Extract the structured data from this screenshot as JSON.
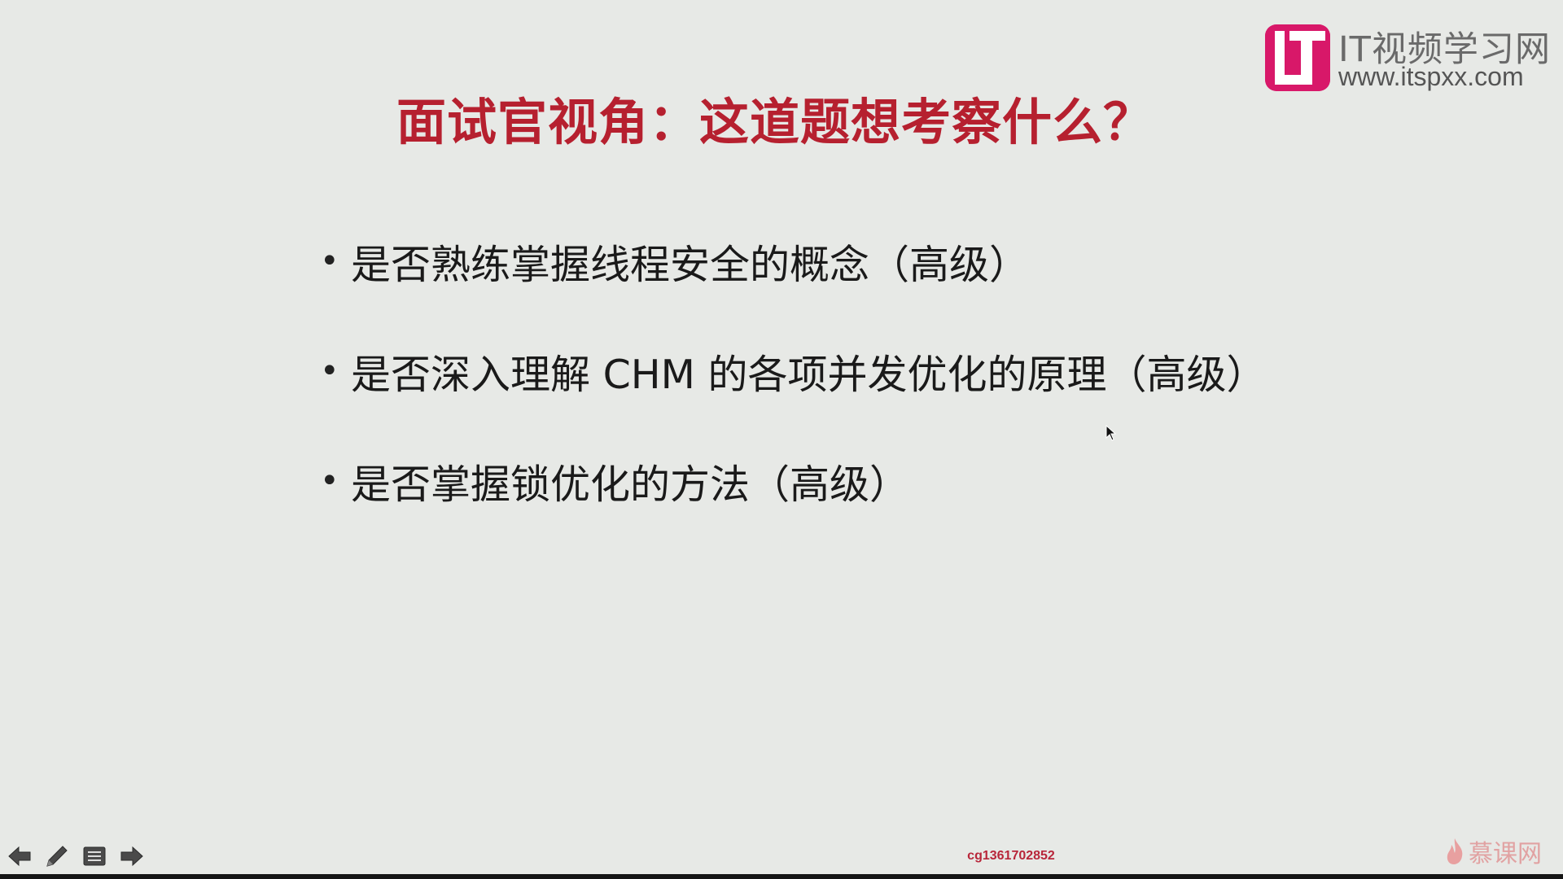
{
  "slide": {
    "title": "面试官视角：这道题想考察什么？",
    "bullets": [
      "是否熟练掌握线程安全的概念（高级）",
      "是否深入理解 CHM 的各项并发优化的原理（高级）",
      "是否掌握锁优化的方法（高级）"
    ],
    "bullet_char": "•"
  },
  "logo": {
    "mark_letters": "IT",
    "title": "IT视频学习网",
    "url": "www.itspxx.com",
    "color": "#d81869"
  },
  "controls": {
    "prev_icon": "arrow-left-icon",
    "pen_icon": "pen-icon",
    "menu_icon": "menu-icon",
    "next_icon": "arrow-right-icon"
  },
  "watermark": {
    "user_id": "cg1361702852",
    "mooc_label": "慕课网"
  },
  "colors": {
    "background": "#e7e9e6",
    "title": "#b6202f",
    "accent": "#d81869"
  }
}
